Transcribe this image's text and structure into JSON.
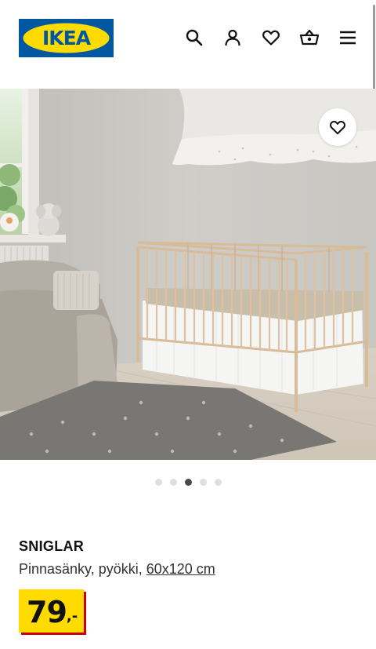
{
  "header": {
    "logo_text": "IKEA",
    "icons": [
      "search-icon",
      "user-icon",
      "heart-icon",
      "basket-icon",
      "menu-icon"
    ]
  },
  "hero": {
    "favorite_icon": "heart-icon",
    "carousel": {
      "count": 5,
      "active_index": 2
    }
  },
  "product": {
    "name": "SNIGLAR",
    "description": "Pinnasänky, pyökki, ",
    "size": "60x120 cm",
    "price_integer": "79",
    "price_suffix": ",-"
  },
  "colors": {
    "ikea_blue": "#0058a3",
    "ikea_yellow": "#ffdb00",
    "price_shadow": "#cc0008"
  }
}
